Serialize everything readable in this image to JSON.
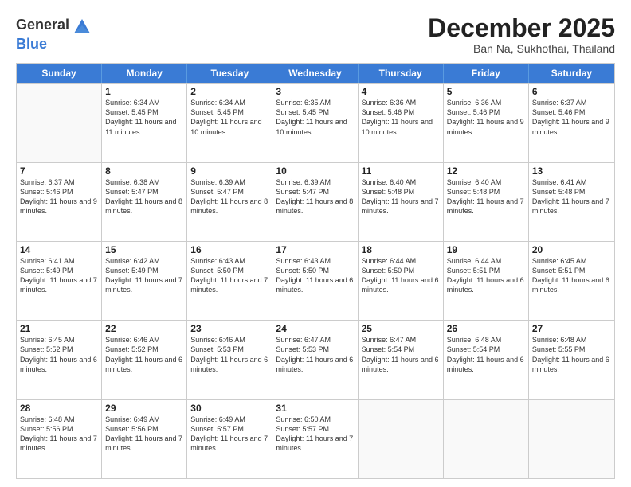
{
  "logo": {
    "general": "General",
    "blue": "Blue"
  },
  "title": "December 2025",
  "subtitle": "Ban Na, Sukhothai, Thailand",
  "headers": [
    "Sunday",
    "Monday",
    "Tuesday",
    "Wednesday",
    "Thursday",
    "Friday",
    "Saturday"
  ],
  "weeks": [
    [
      {
        "day": "",
        "info": ""
      },
      {
        "day": "1",
        "info": "Sunrise: 6:34 AM\nSunset: 5:45 PM\nDaylight: 11 hours and 11 minutes."
      },
      {
        "day": "2",
        "info": "Sunrise: 6:34 AM\nSunset: 5:45 PM\nDaylight: 11 hours and 10 minutes."
      },
      {
        "day": "3",
        "info": "Sunrise: 6:35 AM\nSunset: 5:45 PM\nDaylight: 11 hours and 10 minutes."
      },
      {
        "day": "4",
        "info": "Sunrise: 6:36 AM\nSunset: 5:46 PM\nDaylight: 11 hours and 10 minutes."
      },
      {
        "day": "5",
        "info": "Sunrise: 6:36 AM\nSunset: 5:46 PM\nDaylight: 11 hours and 9 minutes."
      },
      {
        "day": "6",
        "info": "Sunrise: 6:37 AM\nSunset: 5:46 PM\nDaylight: 11 hours and 9 minutes."
      }
    ],
    [
      {
        "day": "7",
        "info": "Sunrise: 6:37 AM\nSunset: 5:46 PM\nDaylight: 11 hours and 9 minutes."
      },
      {
        "day": "8",
        "info": "Sunrise: 6:38 AM\nSunset: 5:47 PM\nDaylight: 11 hours and 8 minutes."
      },
      {
        "day": "9",
        "info": "Sunrise: 6:39 AM\nSunset: 5:47 PM\nDaylight: 11 hours and 8 minutes."
      },
      {
        "day": "10",
        "info": "Sunrise: 6:39 AM\nSunset: 5:47 PM\nDaylight: 11 hours and 8 minutes."
      },
      {
        "day": "11",
        "info": "Sunrise: 6:40 AM\nSunset: 5:48 PM\nDaylight: 11 hours and 7 minutes."
      },
      {
        "day": "12",
        "info": "Sunrise: 6:40 AM\nSunset: 5:48 PM\nDaylight: 11 hours and 7 minutes."
      },
      {
        "day": "13",
        "info": "Sunrise: 6:41 AM\nSunset: 5:48 PM\nDaylight: 11 hours and 7 minutes."
      }
    ],
    [
      {
        "day": "14",
        "info": "Sunrise: 6:41 AM\nSunset: 5:49 PM\nDaylight: 11 hours and 7 minutes."
      },
      {
        "day": "15",
        "info": "Sunrise: 6:42 AM\nSunset: 5:49 PM\nDaylight: 11 hours and 7 minutes."
      },
      {
        "day": "16",
        "info": "Sunrise: 6:43 AM\nSunset: 5:50 PM\nDaylight: 11 hours and 7 minutes."
      },
      {
        "day": "17",
        "info": "Sunrise: 6:43 AM\nSunset: 5:50 PM\nDaylight: 11 hours and 6 minutes."
      },
      {
        "day": "18",
        "info": "Sunrise: 6:44 AM\nSunset: 5:50 PM\nDaylight: 11 hours and 6 minutes."
      },
      {
        "day": "19",
        "info": "Sunrise: 6:44 AM\nSunset: 5:51 PM\nDaylight: 11 hours and 6 minutes."
      },
      {
        "day": "20",
        "info": "Sunrise: 6:45 AM\nSunset: 5:51 PM\nDaylight: 11 hours and 6 minutes."
      }
    ],
    [
      {
        "day": "21",
        "info": "Sunrise: 6:45 AM\nSunset: 5:52 PM\nDaylight: 11 hours and 6 minutes."
      },
      {
        "day": "22",
        "info": "Sunrise: 6:46 AM\nSunset: 5:52 PM\nDaylight: 11 hours and 6 minutes."
      },
      {
        "day": "23",
        "info": "Sunrise: 6:46 AM\nSunset: 5:53 PM\nDaylight: 11 hours and 6 minutes."
      },
      {
        "day": "24",
        "info": "Sunrise: 6:47 AM\nSunset: 5:53 PM\nDaylight: 11 hours and 6 minutes."
      },
      {
        "day": "25",
        "info": "Sunrise: 6:47 AM\nSunset: 5:54 PM\nDaylight: 11 hours and 6 minutes."
      },
      {
        "day": "26",
        "info": "Sunrise: 6:48 AM\nSunset: 5:54 PM\nDaylight: 11 hours and 6 minutes."
      },
      {
        "day": "27",
        "info": "Sunrise: 6:48 AM\nSunset: 5:55 PM\nDaylight: 11 hours and 6 minutes."
      }
    ],
    [
      {
        "day": "28",
        "info": "Sunrise: 6:48 AM\nSunset: 5:56 PM\nDaylight: 11 hours and 7 minutes."
      },
      {
        "day": "29",
        "info": "Sunrise: 6:49 AM\nSunset: 5:56 PM\nDaylight: 11 hours and 7 minutes."
      },
      {
        "day": "30",
        "info": "Sunrise: 6:49 AM\nSunset: 5:57 PM\nDaylight: 11 hours and 7 minutes."
      },
      {
        "day": "31",
        "info": "Sunrise: 6:50 AM\nSunset: 5:57 PM\nDaylight: 11 hours and 7 minutes."
      },
      {
        "day": "",
        "info": ""
      },
      {
        "day": "",
        "info": ""
      },
      {
        "day": "",
        "info": ""
      }
    ]
  ]
}
